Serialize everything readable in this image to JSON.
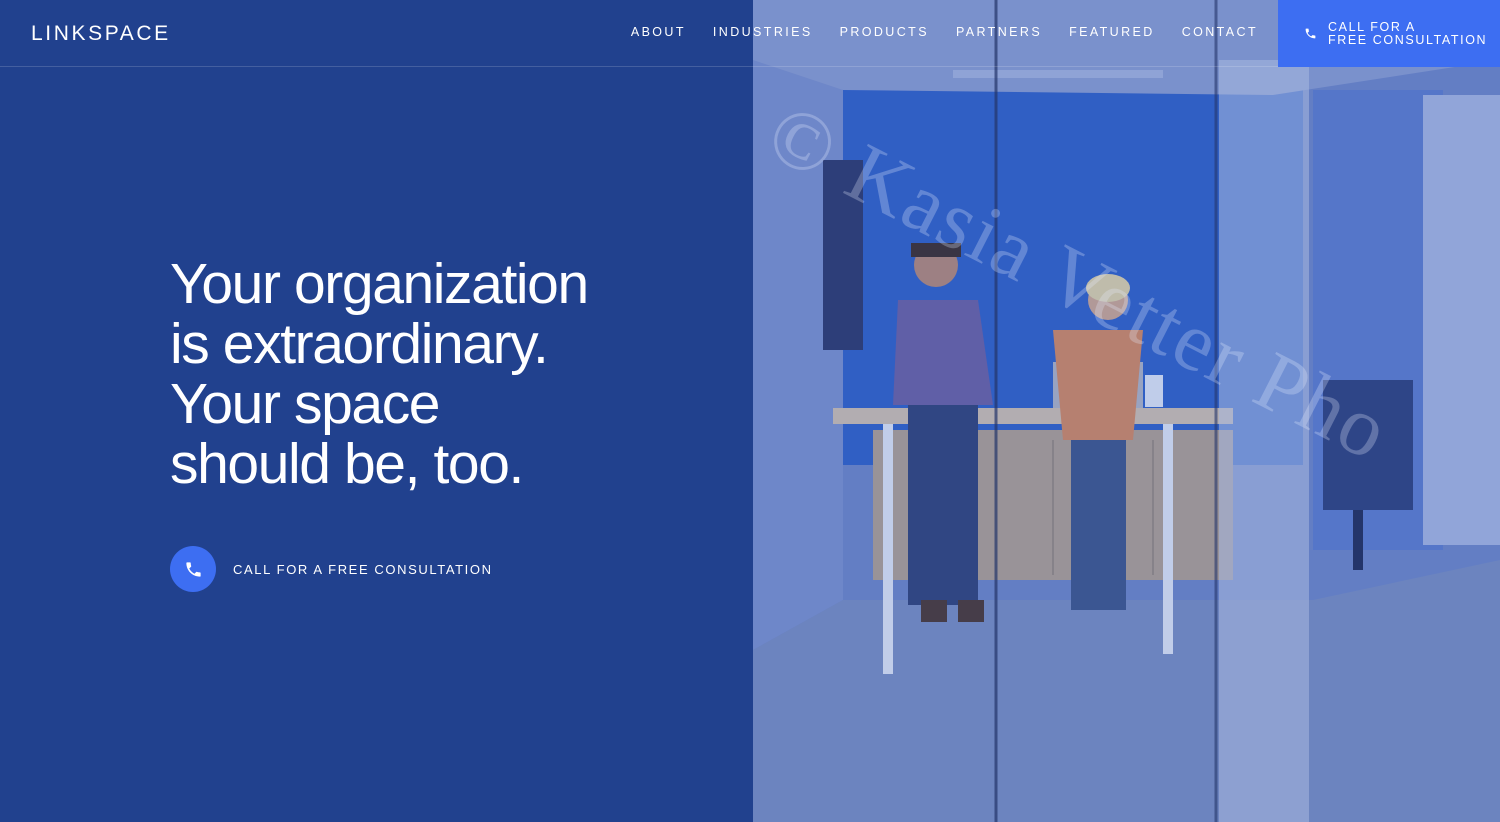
{
  "header": {
    "logo": "LINKSPACE",
    "nav": [
      "ABOUT",
      "INDUSTRIES",
      "PRODUCTS",
      "PARTNERS",
      "FEATURED",
      "CONTACT"
    ],
    "cta": {
      "line1": "CALL FOR A",
      "line2": "FREE CONSULTATION",
      "icon": "phone-icon"
    }
  },
  "hero": {
    "headline": [
      "Your organization",
      "is extraordinary.",
      "Your space",
      "should be, too."
    ],
    "cta": {
      "label": "CALL FOR A FREE CONSULTATION",
      "icon": "phone-icon"
    },
    "photo": {
      "description_visible": false,
      "watermark": "© Kasia Vetter Pho"
    }
  },
  "colors": {
    "background": "#21418e",
    "accent": "#3d6ef2",
    "text": "#ffffff"
  }
}
